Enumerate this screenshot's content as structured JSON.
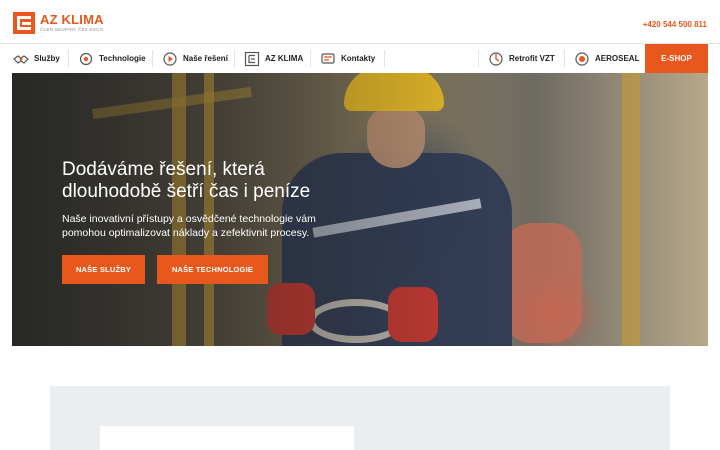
{
  "header": {
    "logo_title": "AZ KLIMA",
    "logo_subtitle": "ČLEN SKUPINY ČEZ ESCO",
    "phone": "+420 544 500 811"
  },
  "nav": {
    "items": [
      {
        "label": "Služby",
        "icon": "handshake-icon"
      },
      {
        "label": "Technologie",
        "icon": "gear-icon"
      },
      {
        "label": "Naše řešení",
        "icon": "play-icon"
      },
      {
        "label": "AZ KLIMA",
        "icon": "logo-icon"
      },
      {
        "label": "Kontakty",
        "icon": "contact-icon"
      },
      {
        "label": "Retrofit VZT",
        "icon": "retrofit-icon"
      },
      {
        "label": "AEROSEAL",
        "icon": "aeroseal-icon"
      }
    ],
    "eshop_label": "E-SHOP"
  },
  "hero": {
    "title_line1": "Dodáváme řešení, která",
    "title_line2": "dlouhodobě šetří čas i peníze",
    "subtitle_line1": "Naše inovativní přístupy a osvědčené technologie vám",
    "subtitle_line2": "pomohou optimalizovat náklady a zefektivnit procesy.",
    "button_services": "NAŠE SLUŽBY",
    "button_technology": "NAŠE TECHNOLOGIE"
  },
  "colors": {
    "accent": "#e8581c",
    "section_gray": "#ebeef1"
  }
}
